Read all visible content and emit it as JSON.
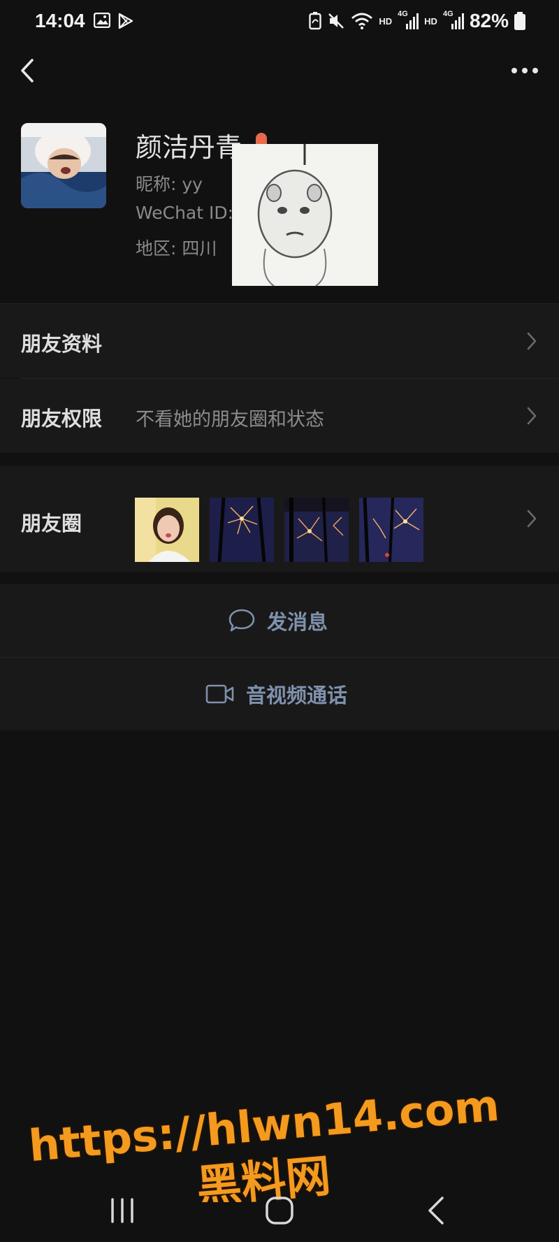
{
  "status_bar": {
    "time": "14:04",
    "battery": "82%",
    "hd1": "HD",
    "hd2": "HD",
    "net1": "4G",
    "net2": "4G",
    "icons": [
      "gallery-icon",
      "play-store-icon",
      "battery-saver-icon",
      "mute-icon",
      "wifi-icon",
      "signal-icon",
      "signal-icon",
      "battery-icon"
    ]
  },
  "nav": {
    "back_icon": "chevron-left-icon",
    "more_icon": "more-dots-icon"
  },
  "profile": {
    "display_name": "颜洁丹青",
    "nickname": "昵称: yy",
    "wechat_id": "WeChat ID:",
    "region": "地区: 四川",
    "gender_color": "#e86a4d"
  },
  "rows": {
    "friend_info": {
      "label": "朋友资料"
    },
    "permissions": {
      "label": "朋友权限",
      "value": "不看她的朋友圈和状态"
    },
    "moments": {
      "label": "朋友圈"
    }
  },
  "actions": {
    "message": {
      "label": "发消息",
      "icon": "chat-bubble-icon"
    },
    "call": {
      "label": "音视频通话",
      "icon": "video-camera-icon"
    }
  },
  "watermark": {
    "url": "https://hlwn14.com",
    "site": "黑料网",
    "color": "#f39a1f"
  },
  "colors": {
    "background": "#111111",
    "row_background": "#191919",
    "action_text": "#7f91ad"
  }
}
